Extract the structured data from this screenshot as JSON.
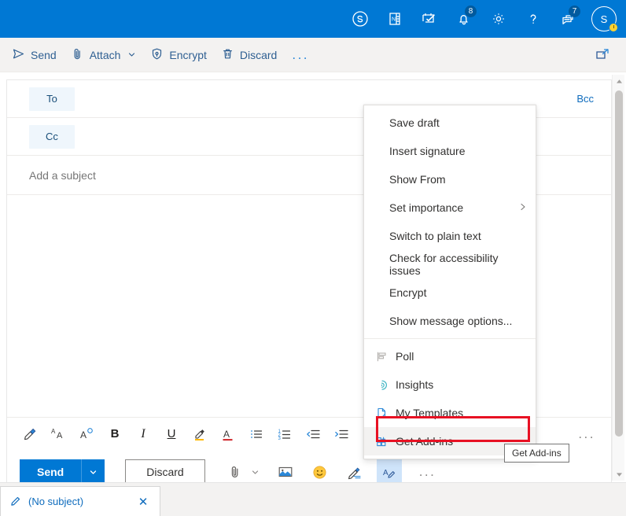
{
  "suite_header": {
    "icons": [
      {
        "name": "skype-icon",
        "label": "Skype"
      },
      {
        "name": "onenote-icon",
        "label": "OneNote"
      },
      {
        "name": "to-do-icon",
        "label": "To Do"
      },
      {
        "name": "notifications-bell-icon",
        "label": "Notifications",
        "badge": "8"
      },
      {
        "name": "settings-gear-icon",
        "label": "Settings"
      },
      {
        "name": "help-question-icon",
        "label": "Help"
      },
      {
        "name": "feedback-icon",
        "label": "Feedback",
        "badge": "7"
      }
    ],
    "avatar_initial": "S",
    "accent_color": "#0078d4"
  },
  "command_bar": {
    "send_label": "Send",
    "attach_label": "Attach",
    "encrypt_label": "Encrypt",
    "discard_label": "Discard",
    "more_label": "...",
    "popout_label": "Open in separate window"
  },
  "compose": {
    "to_label": "To",
    "to_value": "",
    "cc_label": "Cc",
    "cc_value": "",
    "bcc_label": "Bcc",
    "subject_placeholder": "Add a subject",
    "subject_value": "",
    "body_value": ""
  },
  "format_bar": {
    "buttons": [
      {
        "name": "format-painter-icon",
        "label": "Format painter"
      },
      {
        "name": "font-size-icon",
        "label": "Font size"
      },
      {
        "name": "increase-font-size-icon",
        "label": "Increase font size"
      },
      {
        "name": "bold-icon",
        "label": "B"
      },
      {
        "name": "italic-icon",
        "label": "I"
      },
      {
        "name": "underline-icon",
        "label": "U"
      },
      {
        "name": "highlight-icon",
        "label": "Text highlight color"
      },
      {
        "name": "font-color-icon",
        "label": "Font color"
      },
      {
        "name": "bulleted-list-icon",
        "label": "Bulleted list"
      },
      {
        "name": "numbered-list-icon",
        "label": "Numbered list"
      },
      {
        "name": "decrease-indent-icon",
        "label": "Decrease indent"
      },
      {
        "name": "increase-indent-icon",
        "label": "Increase indent"
      }
    ],
    "more_label": "..."
  },
  "action_bar": {
    "send_label": "Send",
    "discard_label": "Discard",
    "attach_label": "Attach file",
    "image_label": "Insert picture inline",
    "emoji_label": "Insert emoji",
    "signature_label": "Insert signature",
    "editor_label": "Editor",
    "more_label": "..."
  },
  "context_menu": {
    "items": [
      {
        "label": "Save draft",
        "icon": null,
        "submenu": false
      },
      {
        "label": "Insert signature",
        "icon": null,
        "submenu": false
      },
      {
        "label": "Show From",
        "icon": null,
        "submenu": false
      },
      {
        "label": "Set importance",
        "icon": null,
        "submenu": true
      },
      {
        "label": "Switch to plain text",
        "icon": null,
        "submenu": false
      },
      {
        "label": "Check for accessibility issues",
        "icon": null,
        "submenu": false
      },
      {
        "label": "Encrypt",
        "icon": null,
        "submenu": false
      },
      {
        "label": "Show message options...",
        "icon": null,
        "submenu": false
      },
      {
        "label": "Poll",
        "icon": "poll-icon",
        "submenu": false
      },
      {
        "label": "Insights",
        "icon": "insights-icon",
        "submenu": false
      },
      {
        "label": "My Templates",
        "icon": "my-templates-icon",
        "submenu": false
      },
      {
        "label": "Get Add-ins",
        "icon": "get-add-ins-icon",
        "submenu": false
      }
    ],
    "highlighted_item": "Get Add-ins",
    "highlight_color": "#e81123"
  },
  "tooltip": {
    "text": "Get Add-ins"
  },
  "tab_strip": {
    "draft_label": "(No subject)",
    "close_label": "✕"
  }
}
